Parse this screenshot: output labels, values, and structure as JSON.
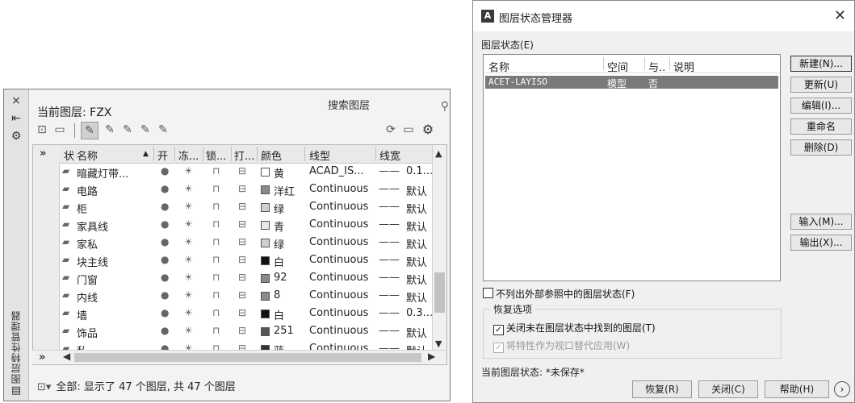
{
  "palette": {
    "side_icons": [
      "×",
      "⇤",
      "⚙"
    ],
    "vertical_title": "图层特性管理器",
    "current_layer": "当前图层: FZX",
    "search_placeholder": "搜索图层",
    "search_icon": "search-icon",
    "toolbar_icons": [
      "new-property-filter-icon",
      "new-group-filter-icon",
      "new-layer-icon",
      "new-layer-vp-frozen-icon",
      "delete-layer-icon",
      "set-current-icon",
      "refresh-icon",
      "settings-icon"
    ],
    "columns": [
      "状",
      "名称",
      "开",
      "冻...",
      "锁...",
      "打...",
      "颜色",
      "线型",
      "线宽"
    ],
    "rows": [
      {
        "name": "暗藏灯带...",
        "color_name": "黄",
        "color": "#ffffff",
        "linetype": "ACAD_IS...",
        "lineweight": "0.1..."
      },
      {
        "name": "电路",
        "color_name": "洋红",
        "color": "#8a8a8a",
        "linetype": "Continuous",
        "lineweight": "默认"
      },
      {
        "name": "柜",
        "color_name": "绿",
        "color": "#cfcfcf",
        "linetype": "Continuous",
        "lineweight": "默认"
      },
      {
        "name": "家具线",
        "color_name": "青",
        "color": "#e8e8e8",
        "linetype": "Continuous",
        "lineweight": "默认"
      },
      {
        "name": "家私",
        "color_name": "绿",
        "color": "#cfcfcf",
        "linetype": "Continuous",
        "lineweight": "默认"
      },
      {
        "name": "块主线",
        "color_name": "白",
        "color": "#111111",
        "linetype": "Continuous",
        "lineweight": "默认"
      },
      {
        "name": "门窗",
        "color_name": "92",
        "color": "#8a8a8a",
        "linetype": "Continuous",
        "lineweight": "默认"
      },
      {
        "name": "内线",
        "color_name": "8",
        "color": "#8a8a8a",
        "linetype": "Continuous",
        "lineweight": "默认"
      },
      {
        "name": "墙",
        "color_name": "白",
        "color": "#111111",
        "linetype": "Continuous",
        "lineweight": "0.3..."
      },
      {
        "name": "饰品",
        "color_name": "251",
        "color": "#555555",
        "linetype": "Continuous",
        "lineweight": "默认"
      },
      {
        "name": "私",
        "color_name": "蓝",
        "color": "#333333",
        "linetype": "Continuous",
        "lineweight": "默认"
      }
    ],
    "status": "全部: 显示了 47 个图层, 共 47 个图层"
  },
  "dialog": {
    "title": "图层状态管理器",
    "section_label": "图层状态(E)",
    "list_headers": [
      "名称",
      "空间",
      "与..",
      "说明"
    ],
    "list_rows": [
      {
        "name": "ACET-LAYISO",
        "space": "模型",
        "same": "否",
        "desc": ""
      }
    ],
    "buttons": {
      "new": "新建(N)...",
      "update": "更新(U)",
      "edit": "编辑(I)...",
      "rename": "重命名",
      "delete": "删除(D)",
      "import": "输入(M)...",
      "export": "输出(X)..."
    },
    "no_xref_label": "不列出外部参照中的图层状态(F)",
    "restore_group": "恢复选项",
    "close_not_found_label": "关闭未在图层状态中找到的图层(T)",
    "apply_vp_label": "将特性作为视口替代应用(W)",
    "current_state": "当前图层状态: *未保存*",
    "bottom": {
      "restore": "恢复(R)",
      "close": "关闭(C)",
      "help": "帮助(H)"
    }
  }
}
